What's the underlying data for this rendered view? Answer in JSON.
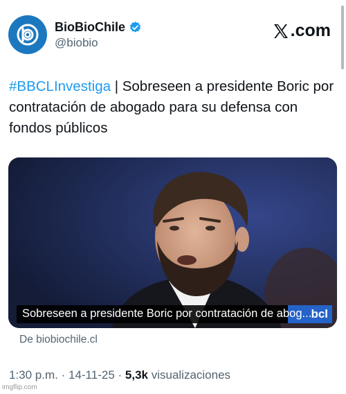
{
  "account": {
    "display_name": "BioBioChile",
    "handle": "@biobio",
    "verified": true,
    "avatar_icon": "biobio-logo-icon",
    "avatar_color": "#1c78be"
  },
  "brand": {
    "icon": "x-logo-icon",
    "suffix": ".com"
  },
  "tweet": {
    "hashtag": "#BBCLInvestiga",
    "separator": " | ",
    "body": "Sobreseen a presidente Boric por contratación de abogado para su defensa con fondos públicos",
    "hashtag_color": "#1d9bf0"
  },
  "media": {
    "caption": "Sobreseen a presidente Boric por contratación de abog...",
    "overlay_logo_text": "bcl",
    "source_label": "De biobiochile.cl"
  },
  "meta": {
    "time": "1:30 p.m.",
    "dot": " · ",
    "date": "14-11-25",
    "views_count": "5,3k",
    "views_label": " visualizaciones"
  },
  "watermark": "imgflip.com"
}
